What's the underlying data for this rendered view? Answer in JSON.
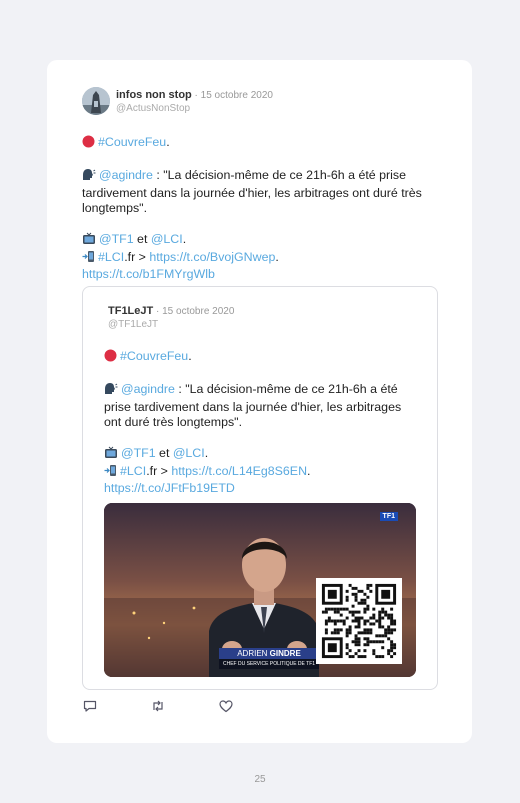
{
  "tweet": {
    "author_name": "infos non stop",
    "date": "15 octobre 2020",
    "separator": " · ",
    "handle": "@ActusNonStop",
    "hashtag": "#CouvreFeu",
    "dot": ".",
    "mention": "@agindre",
    "quote_text": " : \"La décision-même de ce 21h-6h a été prise tardivement dans la journée d'hier, les arbitrages ont duré très longtemps\".",
    "tf1": "@TF1",
    "et": " et ",
    "lci": "@LCI",
    "lci_tag": "#LCI",
    "lci_suffix": ".fr > ",
    "link1": "https://t.co/BvojGNwep",
    "link2": "https://t.co/b1FMYrgWlb"
  },
  "quoted": {
    "author_name": "TF1LeJT",
    "date": "15 octobre 2020",
    "separator": " · ",
    "handle": "@TF1LeJT",
    "hashtag": "#CouvreFeu",
    "dot": ".",
    "mention": "@agindre",
    "quote_text": " : \"La décision-même de ce 21h-6h a été prise tardivement dans la journée d'hier, les arbitrages ont duré très longtemps\".",
    "tf1": "@TF1",
    "et": " et ",
    "lci": "@LCI",
    "lci_tag": "#LCI",
    "lci_suffix": ".fr > ",
    "link1": "https://t.co/L14Eg8S6EN",
    "link2": "https://t.co/JFtFb19ETD",
    "media": {
      "channel_logo": "TF1",
      "lower_third_first": "ADRIEN",
      "lower_third_last": "GINDRE",
      "lower_third_role": "CHEF DU SERVICE POLITIQUE DE TF1"
    }
  },
  "icons": [
    "reply-icon",
    "retweet-icon",
    "like-icon"
  ],
  "page_number": "25",
  "colors": {
    "link": "#59a9df",
    "background": "#f1f2f6",
    "card": "#ffffff"
  }
}
